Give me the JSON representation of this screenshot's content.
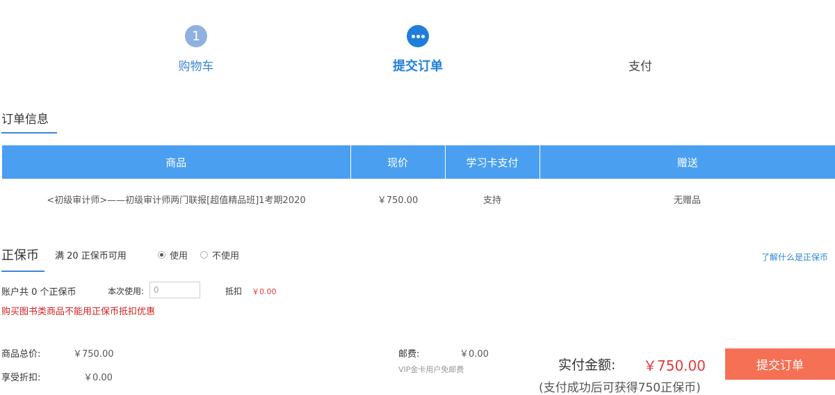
{
  "steps": [
    {
      "number": "1",
      "label": "购物车",
      "state": "done"
    },
    {
      "number": "",
      "label": "提交订单",
      "state": "current",
      "icon": "ellipsis-icon"
    },
    {
      "number": "",
      "label": "支付",
      "state": "pending"
    }
  ],
  "order": {
    "title": "订单信息",
    "columns": [
      "商品",
      "现价",
      "学习卡支付",
      "赠送"
    ],
    "rows": [
      {
        "product": "<初级审计师>——初级审计师两门联报[超值精品班]1考期2020",
        "price": "￥750.00",
        "card_pay": "支持",
        "gift": "无赠品"
      }
    ]
  },
  "coins": {
    "title": "正保币",
    "available_text": "满 20 正保币可用",
    "option_use": "使用",
    "option_not_use": "不使用",
    "selected": "使用",
    "learn_link": "了解什么是正保币",
    "account_text": "账户共 0 个正保币",
    "use_label": "本次使用:",
    "use_placeholder": "0",
    "deduct_label": "抵扣",
    "deduct_value": "￥0.00",
    "warning": "购买图书类商品不能用正保币抵扣优惠"
  },
  "summary": {
    "total_label": "商品总价:",
    "total_value": "￥750.00",
    "discount_label": "享受折扣:",
    "discount_value": "￥0.00",
    "shipping_label": "邮费:",
    "shipping_value": "￥0.00",
    "shipping_note": "VIP金卡用户免邮费",
    "pay_label": "实付金额:",
    "pay_value": "￥750.00",
    "reward_note": "(支付成功后可获得750正保币)",
    "submit_label": "提交订单"
  },
  "colors": {
    "accent": "#1f7ed9",
    "table_header": "#4a9ff0",
    "price_red": "#e4393c",
    "submit_button": "#f57055"
  }
}
